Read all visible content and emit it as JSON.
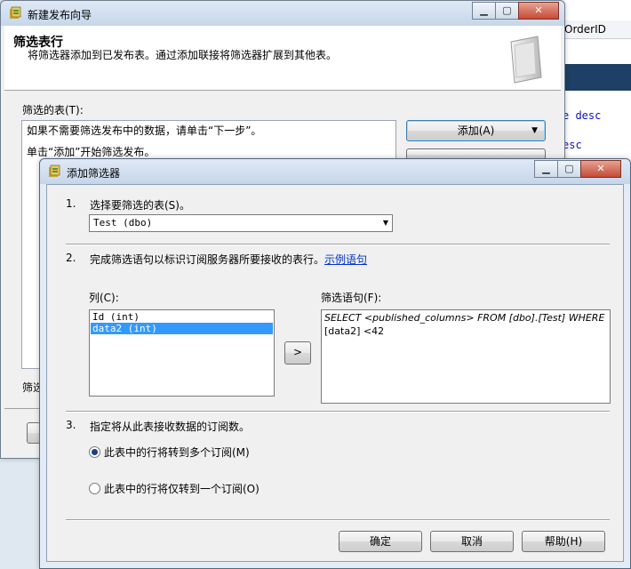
{
  "background": {
    "column_header": "OrderID",
    "code_lines": [
      "e desc",
      "esc"
    ]
  },
  "wizard": {
    "title": "新建发布向导",
    "heading": "筛选表行",
    "subtitle": "将筛选器添加到已发布表。通过添加联接将筛选器扩展到其他表。",
    "filtered_tables_label": "筛选的表(T):",
    "list_lines": [
      "如果不需要筛选发布中的数据，请单击“下一步”。",
      "单击“添加”开始筛选发布。"
    ],
    "add_button": "添加(A)",
    "filter_label_partial": "筛选"
  },
  "dialog": {
    "title": "添加筛选器",
    "step1_num": "1.",
    "step1_text": "选择要筛选的表(S)。",
    "table_selected": "Test (dbo)",
    "step2_num": "2.",
    "step2_text": "完成筛选语句以标识订阅服务器所要接收的表行。",
    "example_link": "示例语句",
    "columns_label": "列(C):",
    "columns": [
      "Id (int)",
      "data2 (int)"
    ],
    "selected_column_index": 1,
    "move_button": ">",
    "statement_label": "筛选语句(F):",
    "statement_line1": "SELECT <published_columns> FROM [dbo].[Test] WHERE",
    "statement_line2": "[data2] <42",
    "step3_num": "3.",
    "step3_text": "指定将从此表接收数据的订阅数。",
    "radio_multi": "此表中的行将转到多个订阅(M)",
    "radio_single": "此表中的行将仅转到一个订阅(O)",
    "radio_selected": "multi",
    "ok_button": "确定",
    "cancel_button": "取消",
    "help_button": "帮助(H)"
  },
  "colors": {
    "link": "#0033cc",
    "selection": "#3399ff",
    "title_gradient_top": "#dfe9f5"
  }
}
